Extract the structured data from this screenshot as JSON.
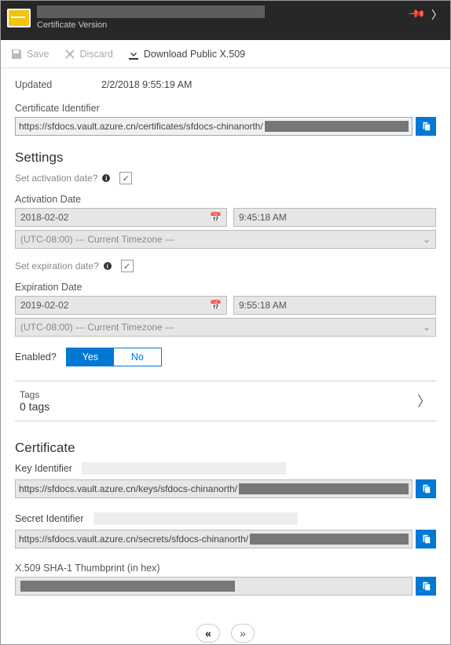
{
  "header": {
    "subtitle": "Certificate Version",
    "pin_icon": "pin-icon",
    "arrow_icon": "chevron-right-icon"
  },
  "toolbar": {
    "save": "Save",
    "discard": "Discard",
    "download": "Download Public X.509"
  },
  "updated": {
    "label": "Updated",
    "value": "2/2/2018 9:55:19 AM"
  },
  "cert_id": {
    "label": "Certificate Identifier",
    "value": "https://sfdocs.vault.azure.cn/certificates/sfdocs-chinanorth/"
  },
  "settings": {
    "title": "Settings",
    "activation_q": "Set activation date?",
    "activation_label": "Activation Date",
    "activation_date": "2018-02-02",
    "activation_time": "9:45:18 AM",
    "tz": "(UTC-08:00) --- Current Timezone ---",
    "expiration_q": "Set expiration date?",
    "expiration_label": "Expiration Date",
    "expiration_date": "2019-02-02",
    "expiration_time": "9:55:18 AM",
    "enabled_label": "Enabled?",
    "enabled_yes": "Yes",
    "enabled_no": "No"
  },
  "tags": {
    "label": "Tags",
    "count": "0 tags"
  },
  "certificate": {
    "title": "Certificate",
    "key_id_label": "Key Identifier",
    "key_id_value": "https://sfdocs.vault.azure.cn/keys/sfdocs-chinanorth/",
    "secret_id_label": "Secret Identifier",
    "secret_id_value": "https://sfdocs.vault.azure.cn/secrets/sfdocs-chinanorth/",
    "thumb_label": "X.509 SHA-1 Thumbprint (in hex)"
  }
}
